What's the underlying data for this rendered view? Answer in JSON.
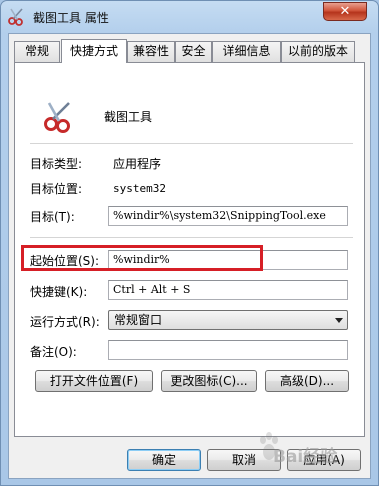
{
  "window": {
    "title": "截图工具 属性",
    "close_glyph": "✕",
    "icon": "scissors-icon"
  },
  "tabs": [
    {
      "label": "常规",
      "active": false
    },
    {
      "label": "快捷方式",
      "active": true
    },
    {
      "label": "兼容性",
      "active": false
    },
    {
      "label": "安全",
      "active": false
    },
    {
      "label": "详细信息",
      "active": false
    },
    {
      "label": "以前的版本",
      "active": false
    }
  ],
  "program": {
    "name": "截图工具",
    "icon": "scissors-icon"
  },
  "info": {
    "target_type_label": "目标类型:",
    "target_type_value": "应用程序",
    "target_location_label": "目标位置:",
    "target_location_value": "system32"
  },
  "fields": {
    "target_label": "目标(T):",
    "target_value": "%windir%\\system32\\SnippingTool.exe",
    "start_in_label": "起始位置(S):",
    "start_in_value": "%windir%",
    "shortcut_key_label": "快捷键(K):",
    "shortcut_key_value": "Ctrl + Alt + S",
    "run_label": "运行方式(R):",
    "run_value": "常规窗口",
    "comment_label": "备注(O):",
    "comment_value": ""
  },
  "action_buttons": {
    "open_location": "打开文件位置(F)",
    "change_icon": "更改图标(C)...",
    "advanced": "高级(D)..."
  },
  "dialog_buttons": {
    "ok": "确定",
    "cancel": "取消",
    "apply": "应用(A)"
  },
  "annotation": {
    "highlight_color": "#d61f26"
  },
  "watermark": {
    "text": "Bai经验",
    "icon": "paw-icon"
  }
}
